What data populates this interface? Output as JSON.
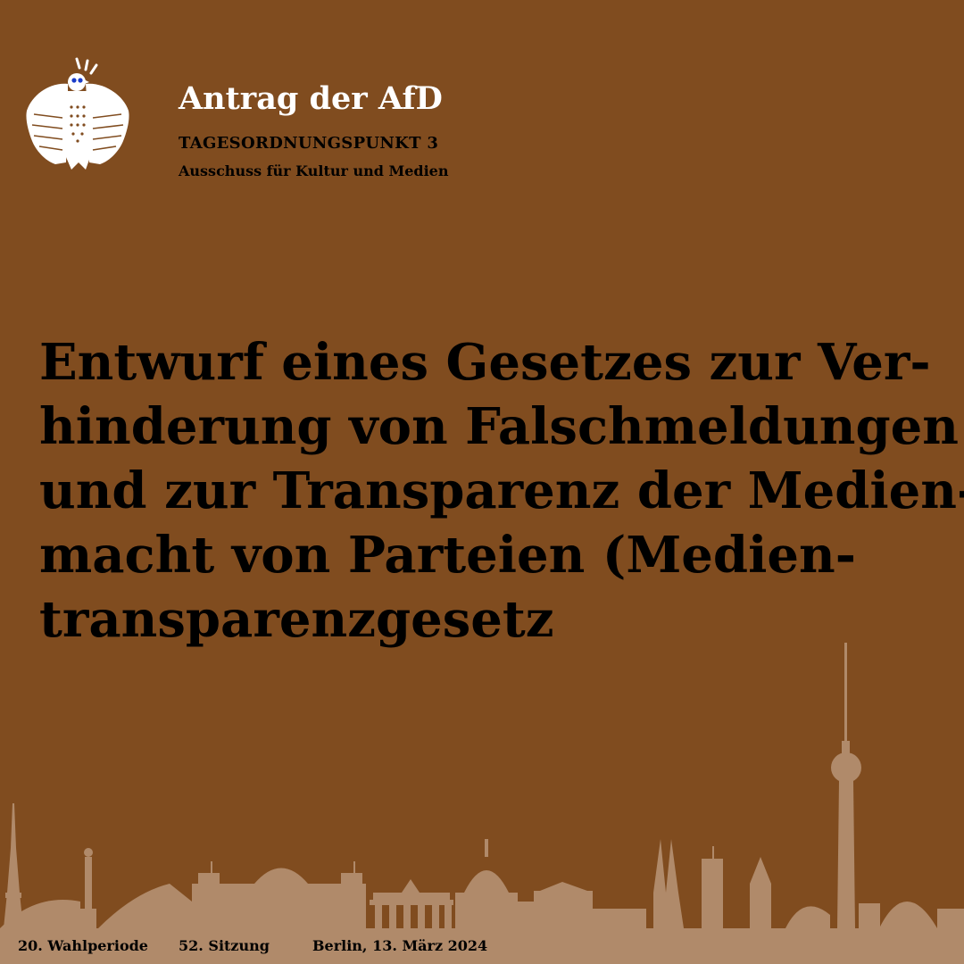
{
  "header": {
    "title": "Antrag der AfD",
    "agenda_item": "TAGESORDNUNGSPUNKT  3",
    "committee": "Ausschuss für Kultur und Medien"
  },
  "headline": {
    "lines": [
      "Entwurf eines Gesetzes zur Ver-",
      "hinderung von Falschmeldungen",
      "und zur Transparenz der Medien-",
      "macht von Parteien (Medien-",
      "transparenzgesetz"
    ]
  },
  "footer": {
    "period": "20. Wahlperiode",
    "session": "52. Sitzung",
    "place_date": "Berlin, 13. März 2024"
  },
  "colors": {
    "background": "#804c1f",
    "skyline": "#b08a6a",
    "title": "#ffffff",
    "text": "#000000",
    "eagle_eye": "#1a3cc8"
  },
  "icons": {
    "logo": "bundesadler-eagle-icon",
    "skyline": "berlin-skyline-silhouette"
  }
}
